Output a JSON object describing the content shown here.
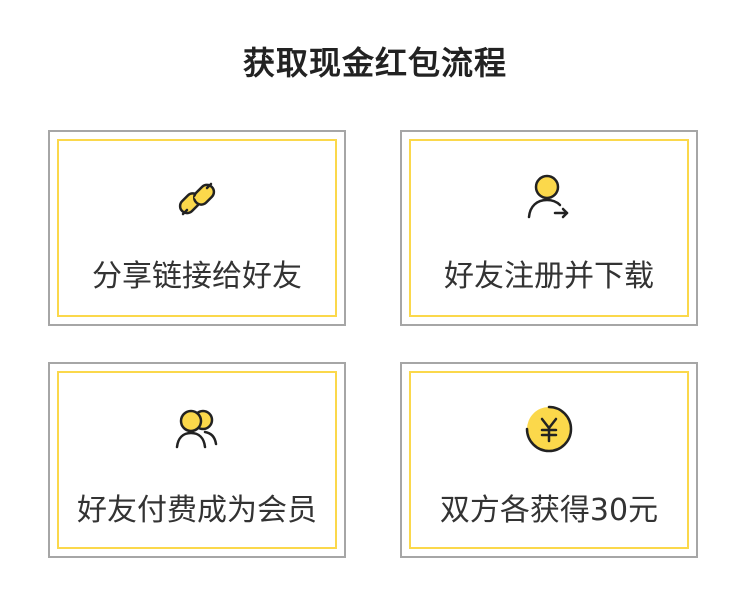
{
  "title": "获取现金红包流程",
  "steps": [
    {
      "label": "分享链接给好友",
      "icon": "link-icon"
    },
    {
      "label": "好友注册并下载",
      "icon": "user-register-icon"
    },
    {
      "label": "好友付费成为会员",
      "icon": "users-icon"
    },
    {
      "label": "双方各获得30元",
      "icon": "yuan-coin-icon"
    }
  ],
  "colors": {
    "accent": "#fbd84b",
    "icon_stroke": "#222222",
    "outer_border": "#a6a6a6"
  }
}
